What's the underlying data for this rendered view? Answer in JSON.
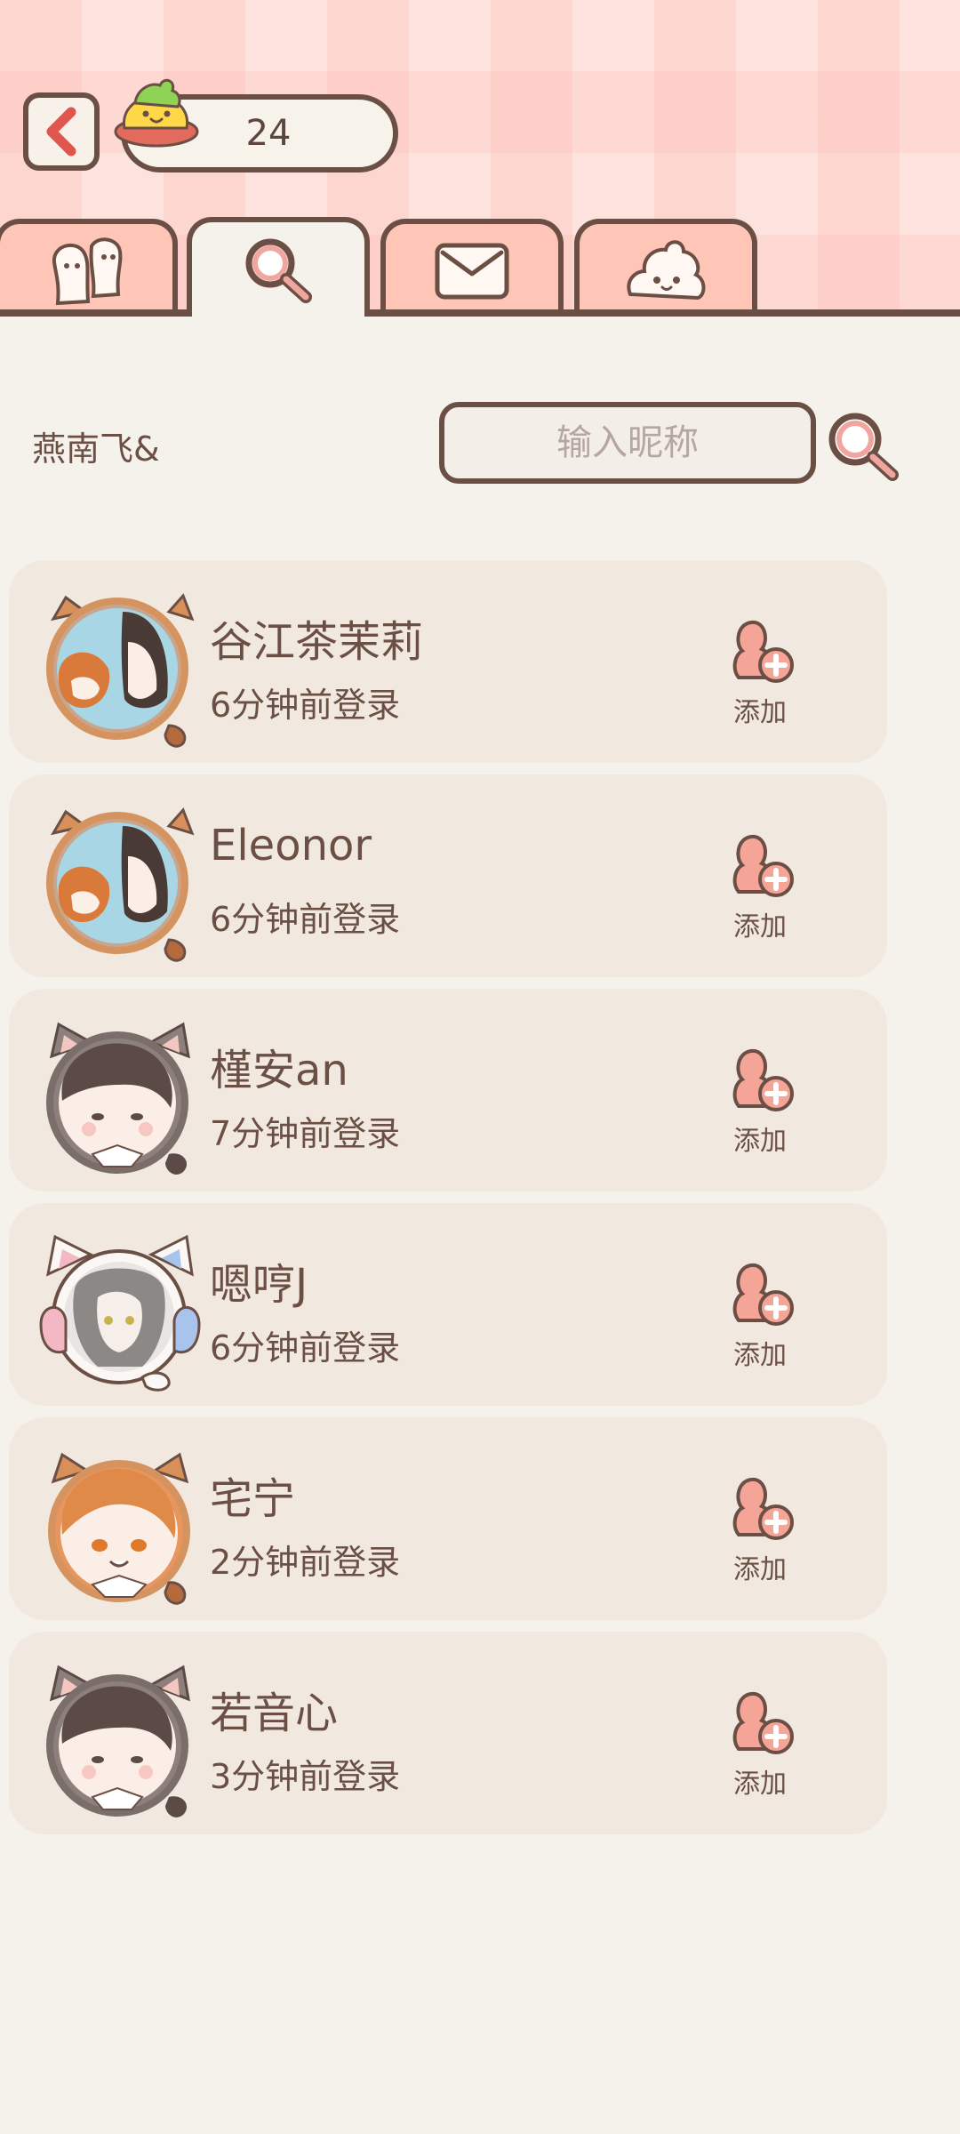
{
  "header": {
    "coin_count": "24",
    "tabs": [
      {
        "icon": "friends-icon"
      },
      {
        "icon": "search-icon",
        "active": true
      },
      {
        "icon": "mail-icon"
      },
      {
        "icon": "blob-icon"
      }
    ]
  },
  "search": {
    "username": "燕南飞&",
    "placeholder": "输入昵称"
  },
  "friends": [
    {
      "name": "谷江茶茉莉",
      "status": "6分钟前登录",
      "add_label": "添加",
      "avatar": "red-panda-girl"
    },
    {
      "name": "Eleonor",
      "status": "6分钟前登录",
      "add_label": "添加",
      "avatar": "red-panda-girl"
    },
    {
      "name": "槿安an",
      "status": "7分钟前登录",
      "add_label": "添加",
      "avatar": "cat-boy"
    },
    {
      "name": "嗯哼J",
      "status": "6分钟前登录",
      "add_label": "添加",
      "avatar": "white-cat-headphones"
    },
    {
      "name": "宅宁",
      "status": "2分钟前登录",
      "add_label": "添加",
      "avatar": "red-panda-boy"
    },
    {
      "name": "若音心",
      "status": "3分钟前登录",
      "add_label": "添加",
      "avatar": "cat-boy"
    }
  ],
  "colors": {
    "outline": "#6b4f45",
    "tab_pink": "#ffc5b7",
    "card": "#f1e9df",
    "accent": "#f0a59e"
  }
}
